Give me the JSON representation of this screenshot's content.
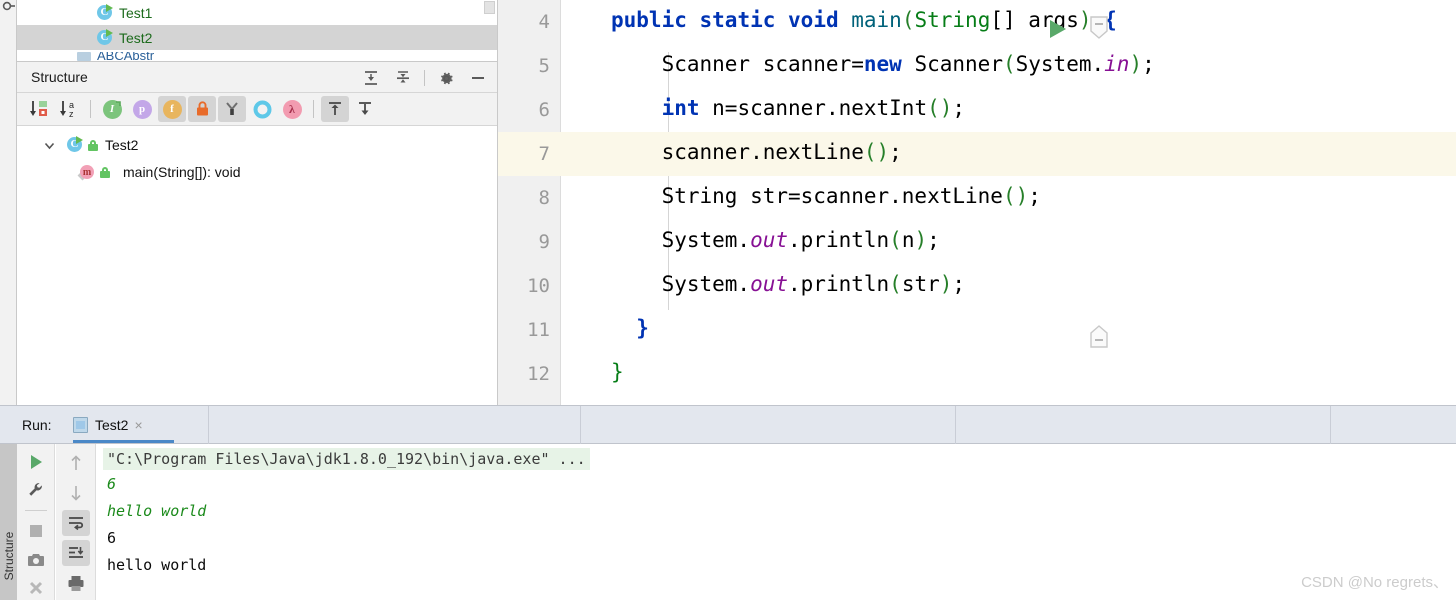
{
  "app": {
    "watermark": "CSDN @No regrets、"
  },
  "project_tree": {
    "items": [
      {
        "label": "Test1",
        "icon": "java-class-runnable-icon",
        "selected": false
      },
      {
        "label": "Test2",
        "icon": "java-class-runnable-icon",
        "selected": true
      }
    ],
    "partial_item_label": "ABCAbstr"
  },
  "structure_panel": {
    "title": "Structure",
    "header_actions": [
      {
        "name": "expand-all-icon",
        "tooltip": "Expand All"
      },
      {
        "name": "collapse-all-icon",
        "tooltip": "Collapse All"
      },
      {
        "name": "gear-icon",
        "tooltip": "Settings"
      },
      {
        "name": "minimize-icon",
        "tooltip": "Hide"
      }
    ],
    "toolbar": [
      {
        "name": "sort-by-visibility-icon",
        "active": false
      },
      {
        "name": "sort-alphabetically-icon",
        "active": false
      },
      {
        "name": "show-inherited-icon",
        "active": false,
        "glyph": "I",
        "color": "#7cc47c"
      },
      {
        "name": "show-properties-icon",
        "active": false,
        "glyph": "p",
        "color": "#c3a7e8"
      },
      {
        "name": "show-fields-icon",
        "active": true,
        "glyph": "f",
        "color": "#e8b55e"
      },
      {
        "name": "show-non-public-icon",
        "active": true,
        "glyph": "lock",
        "color": "#e86b2a"
      },
      {
        "name": "show-anonymous-classes-icon",
        "active": true,
        "glyph": "Y",
        "color": "#8a8a8a"
      },
      {
        "name": "show-interfaces-icon",
        "active": false,
        "glyph": "O",
        "color": "#5ec8e8"
      },
      {
        "name": "show-lambdas-icon",
        "active": false,
        "glyph": "λ",
        "color": "#f29bb0"
      },
      {
        "name": "scroll-from-source-icon",
        "active": true
      },
      {
        "name": "scroll-to-source-icon",
        "active": false
      }
    ],
    "tree": [
      {
        "label": "Test2",
        "icon": "java-class-icon",
        "modifier": "public-lock-icon",
        "expanded": true,
        "depth": 0
      },
      {
        "label": "main(String[]): void",
        "icon": "java-method-icon",
        "modifier": "public-lock-icon",
        "depth": 1
      }
    ]
  },
  "editor": {
    "first_line": 4,
    "caret_line": 7,
    "lines": [
      {
        "number": "4",
        "caret": false,
        "has_run_gutter": true,
        "fold": "down",
        "tokens": [
          {
            "t": "public ",
            "c": "kw"
          },
          {
            "t": "static ",
            "c": "kw"
          },
          {
            "t": "void ",
            "c": "kw"
          },
          {
            "t": "main",
            "c": "fn"
          },
          {
            "t": "(",
            "c": "pn"
          },
          {
            "t": "String",
            "c": "st"
          },
          {
            "t": "[] args",
            "c": "pl"
          },
          {
            "t": ")",
            "c": "pn"
          },
          {
            "t": " {",
            "c": "kw"
          }
        ]
      },
      {
        "number": "5",
        "caret": false,
        "tokens": [
          {
            "t": "    Scanner scanner=",
            "c": "pl"
          },
          {
            "t": "new",
            "c": "kw"
          },
          {
            "t": " Scanner",
            "c": "pl"
          },
          {
            "t": "(",
            "c": "pn"
          },
          {
            "t": "System.",
            "c": "pl"
          },
          {
            "t": "in",
            "c": "fld"
          },
          {
            "t": ")",
            "c": "pn"
          },
          {
            "t": ";",
            "c": "pl"
          }
        ]
      },
      {
        "number": "6",
        "caret": false,
        "tokens": [
          {
            "t": "    ",
            "c": "pl"
          },
          {
            "t": "int",
            "c": "kw"
          },
          {
            "t": " n=scanner.nextInt",
            "c": "pl"
          },
          {
            "t": "()",
            "c": "pn"
          },
          {
            "t": ";",
            "c": "pl"
          }
        ]
      },
      {
        "number": "7",
        "caret": true,
        "tokens": [
          {
            "t": "    scanner.nextLine",
            "c": "pl"
          },
          {
            "t": "()",
            "c": "pn"
          },
          {
            "t": ";",
            "c": "pl"
          }
        ]
      },
      {
        "number": "8",
        "caret": false,
        "tokens": [
          {
            "t": "    String str=scanner.nextLine",
            "c": "pl"
          },
          {
            "t": "()",
            "c": "pn"
          },
          {
            "t": ";",
            "c": "pl"
          }
        ]
      },
      {
        "number": "9",
        "caret": false,
        "tokens": [
          {
            "t": "    System.",
            "c": "pl"
          },
          {
            "t": "out",
            "c": "fld"
          },
          {
            "t": ".println",
            "c": "pl"
          },
          {
            "t": "(",
            "c": "pn"
          },
          {
            "t": "n",
            "c": "pl"
          },
          {
            "t": ")",
            "c": "pn"
          },
          {
            "t": ";",
            "c": "pl"
          }
        ]
      },
      {
        "number": "10",
        "caret": false,
        "tokens": [
          {
            "t": "    System.",
            "c": "pl"
          },
          {
            "t": "out",
            "c": "fld"
          },
          {
            "t": ".println",
            "c": "pl"
          },
          {
            "t": "(",
            "c": "pn"
          },
          {
            "t": "str",
            "c": "pl"
          },
          {
            "t": ")",
            "c": "pn"
          },
          {
            "t": ";",
            "c": "pl"
          }
        ]
      },
      {
        "number": "11",
        "caret": false,
        "fold": "up",
        "tokens": [
          {
            "t": "  }",
            "c": "kw"
          }
        ]
      },
      {
        "number": "12",
        "caret": false,
        "tokens": [
          {
            "t": "}",
            "c": "st"
          }
        ]
      }
    ]
  },
  "run_panel": {
    "label": "Run:",
    "tab": {
      "label": "Test2",
      "close": "×",
      "icon": "console-tab-icon"
    },
    "toolbar_left": [
      {
        "name": "rerun-icon",
        "active": false
      },
      {
        "name": "settings-wrench-icon",
        "active": false
      },
      {
        "name": "stop-icon",
        "active": false
      },
      {
        "name": "screenshot-camera-icon",
        "active": false
      },
      {
        "name": "pin-icon",
        "active": false
      }
    ],
    "toolbar_right": [
      {
        "name": "scroll-up-icon",
        "active": false
      },
      {
        "name": "scroll-down-icon",
        "active": false
      },
      {
        "name": "soft-wrap-icon",
        "active": true
      },
      {
        "name": "scroll-to-end-icon",
        "active": true
      },
      {
        "name": "print-icon",
        "active": false
      }
    ],
    "console": [
      {
        "text": "\"C:\\Program Files\\Java\\jdk1.8.0_192\\bin\\java.exe\" ...",
        "style": "con-cmd"
      },
      {
        "text": "6",
        "style": "con-echo"
      },
      {
        "text": "hello world",
        "style": "con-echo"
      },
      {
        "text": "6",
        "style": "con-out"
      },
      {
        "text": "hello world",
        "style": "con-out"
      }
    ]
  },
  "bottom_bar": {
    "structure_tab_label": "Structure"
  }
}
